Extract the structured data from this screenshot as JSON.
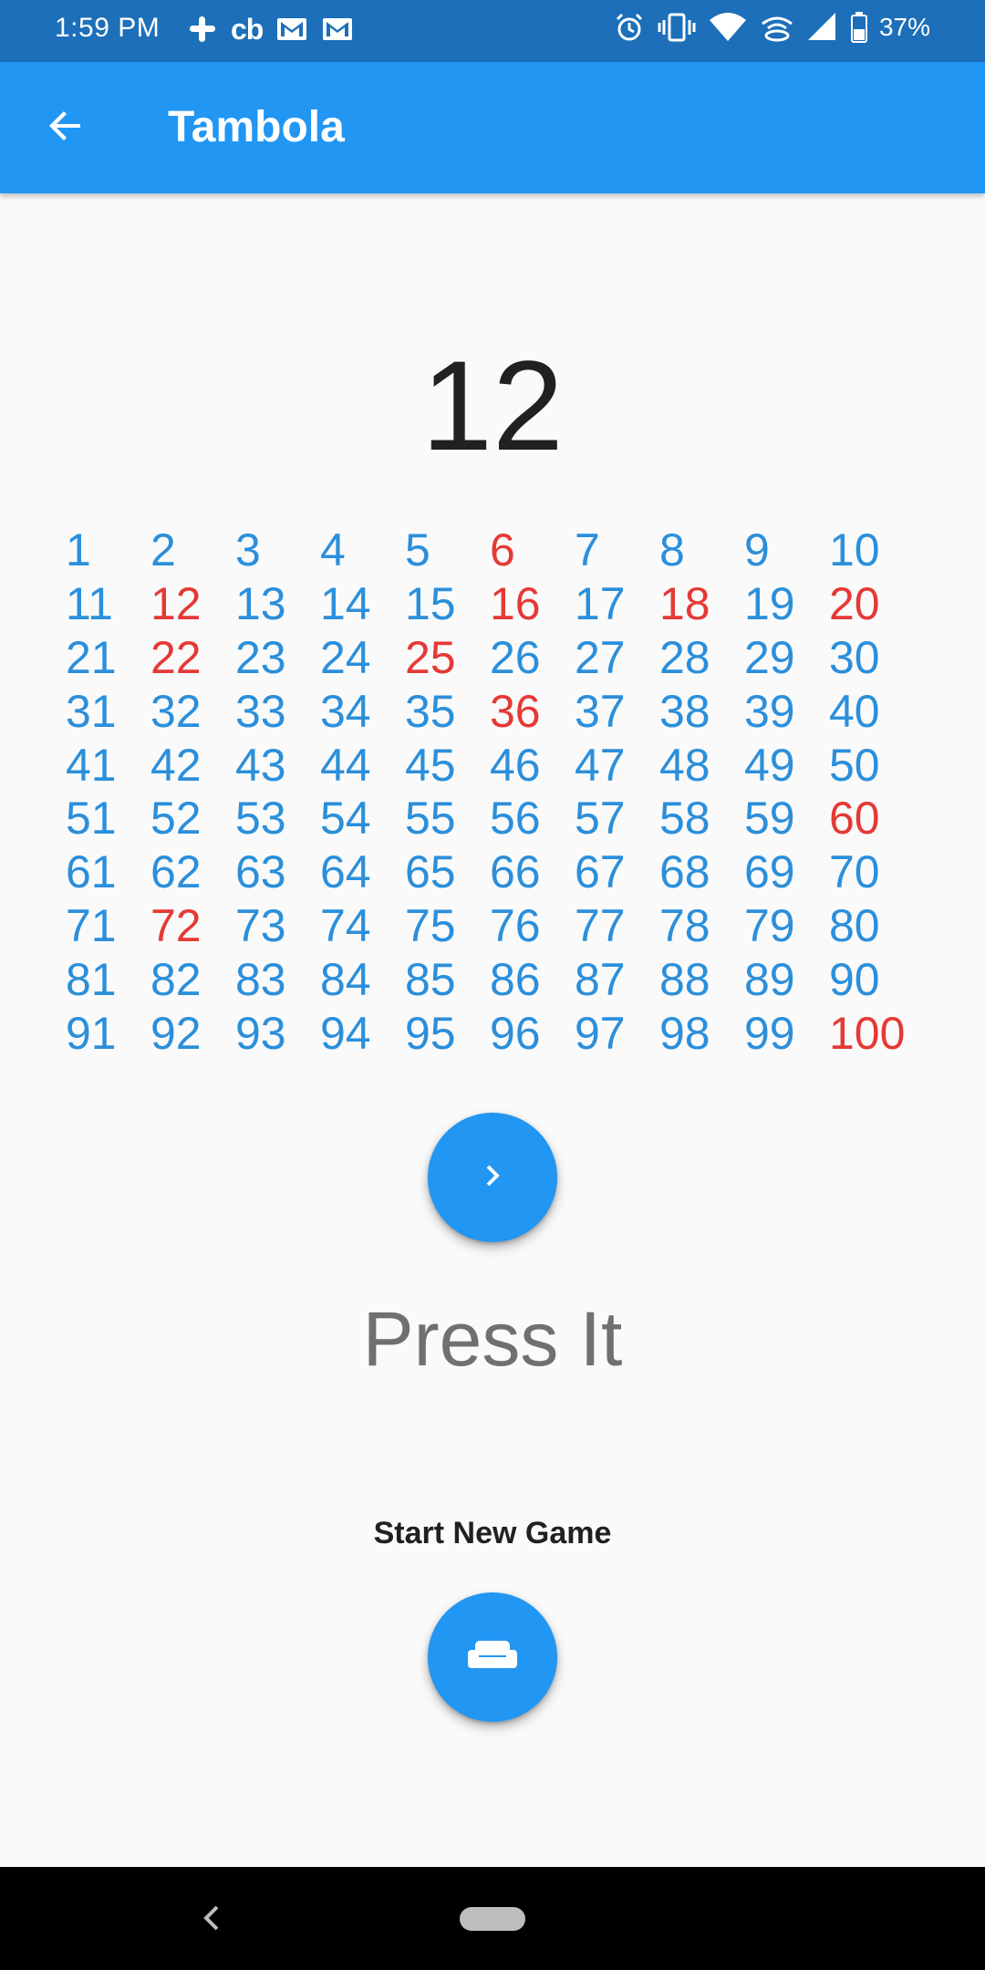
{
  "status_bar": {
    "time": "1:59 PM",
    "cb_label": "cb",
    "battery_percent": "37%",
    "left_icons": [
      "slack-icon",
      "cb-icon",
      "gmail-icon",
      "gmail-icon"
    ],
    "right_icons": [
      "alarm-icon",
      "vibrate-icon",
      "wifi-icon",
      "hotspot-icon",
      "signal-icon",
      "battery-icon"
    ]
  },
  "app_bar": {
    "title": "Tambola",
    "back_icon": "arrow-back-icon"
  },
  "current_number": "12",
  "board": {
    "rows": [
      [
        "1",
        "2",
        "3",
        "4",
        "5",
        "6",
        "7",
        "8",
        "9",
        "10"
      ],
      [
        "11",
        "12",
        "13",
        "14",
        "15",
        "16",
        "17",
        "18",
        "19",
        "20"
      ],
      [
        "21",
        "22",
        "23",
        "24",
        "25",
        "26",
        "27",
        "28",
        "29",
        "30"
      ],
      [
        "31",
        "32",
        "33",
        "34",
        "35",
        "36",
        "37",
        "38",
        "39",
        "40"
      ],
      [
        "41",
        "42",
        "43",
        "44",
        "45",
        "46",
        "47",
        "48",
        "49",
        "50"
      ],
      [
        "51",
        "52",
        "53",
        "54",
        "55",
        "56",
        "57",
        "58",
        "59",
        "60"
      ],
      [
        "61",
        "62",
        "63",
        "64",
        "65",
        "66",
        "67",
        "68",
        "69",
        "70"
      ],
      [
        "71",
        "72",
        "73",
        "74",
        "75",
        "76",
        "77",
        "78",
        "79",
        "80"
      ],
      [
        "81",
        "82",
        "83",
        "84",
        "85",
        "86",
        "87",
        "88",
        "89",
        "90"
      ],
      [
        "91",
        "92",
        "93",
        "94",
        "95",
        "96",
        "97",
        "98",
        "99",
        "100"
      ]
    ],
    "called_numbers": [
      6,
      12,
      16,
      18,
      20,
      22,
      25,
      36,
      60,
      72,
      100
    ],
    "colors": {
      "uncalled": "#2B8FDB",
      "called": "#E53935"
    }
  },
  "next_button": {
    "icon": "chevron-right-icon"
  },
  "press_label": "Press It",
  "new_game": {
    "label": "Start New Game",
    "icon": "couch-icon"
  },
  "colors": {
    "primary": "#2196F3",
    "status_bar": "#1C6FB8",
    "background": "#FAFAFA"
  }
}
